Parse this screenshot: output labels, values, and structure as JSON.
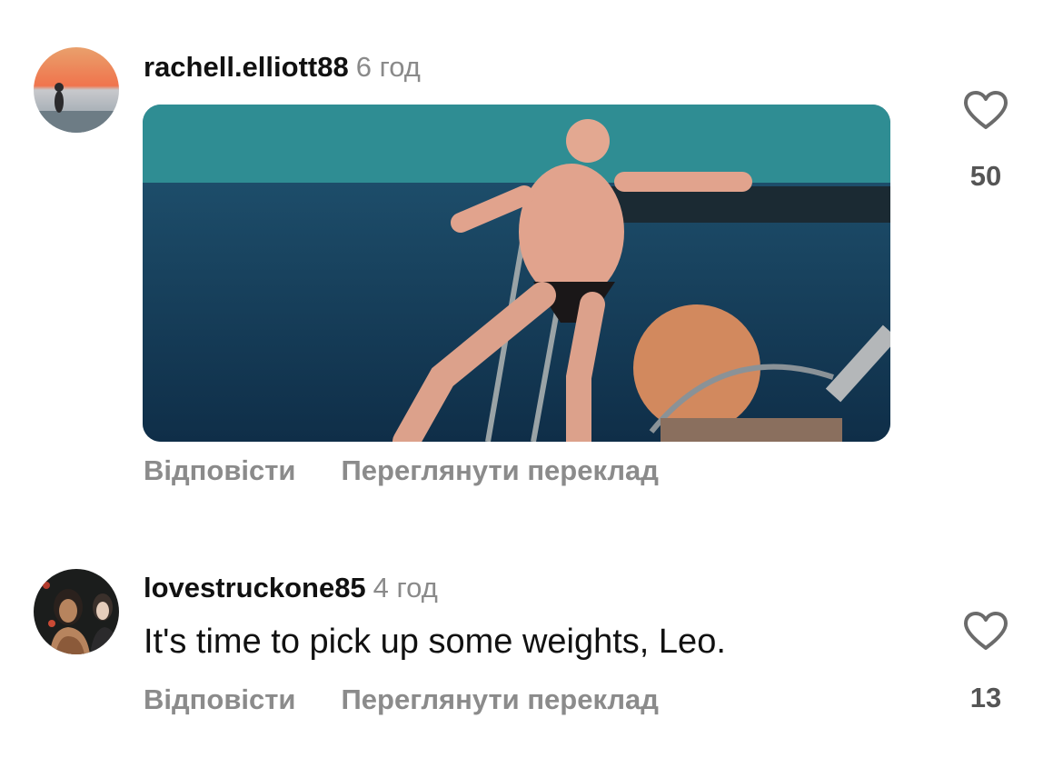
{
  "comments": [
    {
      "username": "rachell.elliott88",
      "time": "6 год",
      "reply_label": "Відповісти",
      "translate_label": "Переглянути переклад",
      "likes": "50",
      "icons": {
        "like": "heart-outline-icon"
      },
      "colors": {
        "username": "#111111",
        "meta": "#8a8a8a"
      }
    },
    {
      "username": "lovestruckone85",
      "time": "4 год",
      "text": "It's time to pick up some weights, Leo.",
      "reply_label": "Відповісти",
      "translate_label": "Переглянути переклад",
      "likes": "13",
      "icons": {
        "like": "heart-outline-icon"
      }
    }
  ]
}
